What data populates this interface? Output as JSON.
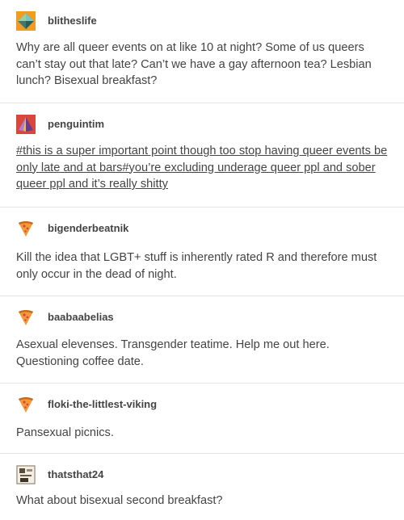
{
  "posts": [
    {
      "username": "blitheslife",
      "avatar_icon": "orange-square-diamond-avatar",
      "text": "Why are all queer events on at like 10 at night? Some of us queers can’t stay out that late? Can’t we have a gay afternoon tea? Lesbian lunch? Bisexual breakfast?"
    },
    {
      "username": "penguintim",
      "avatar_icon": "red-square-pyramid-avatar",
      "text": "#this is a super important point though too stop having queer events be only late and at bars#you’re excluding underage queer ppl and sober queer ppl and it’s really shitty"
    },
    {
      "username": "bigenderbeatnik",
      "avatar_icon": "pizza-slice-avatar",
      "text": "Kill the idea that LGBT+ stuff is inherently rated R and therefore must only occur in the dead of night."
    },
    {
      "username": "baabaabelias",
      "avatar_icon": "pizza-slice-avatar",
      "text": "Asexual elevenses. Transgender teatime. Help me out here. Questioning coffee date."
    },
    {
      "username": "floki-the-littlest-viking",
      "avatar_icon": "pizza-slice-avatar",
      "text": "Pansexual picnics."
    },
    {
      "username": "thatsthat24",
      "avatar_icon": "photo-avatar",
      "text": "What about bisexual second breakfast?"
    }
  ]
}
